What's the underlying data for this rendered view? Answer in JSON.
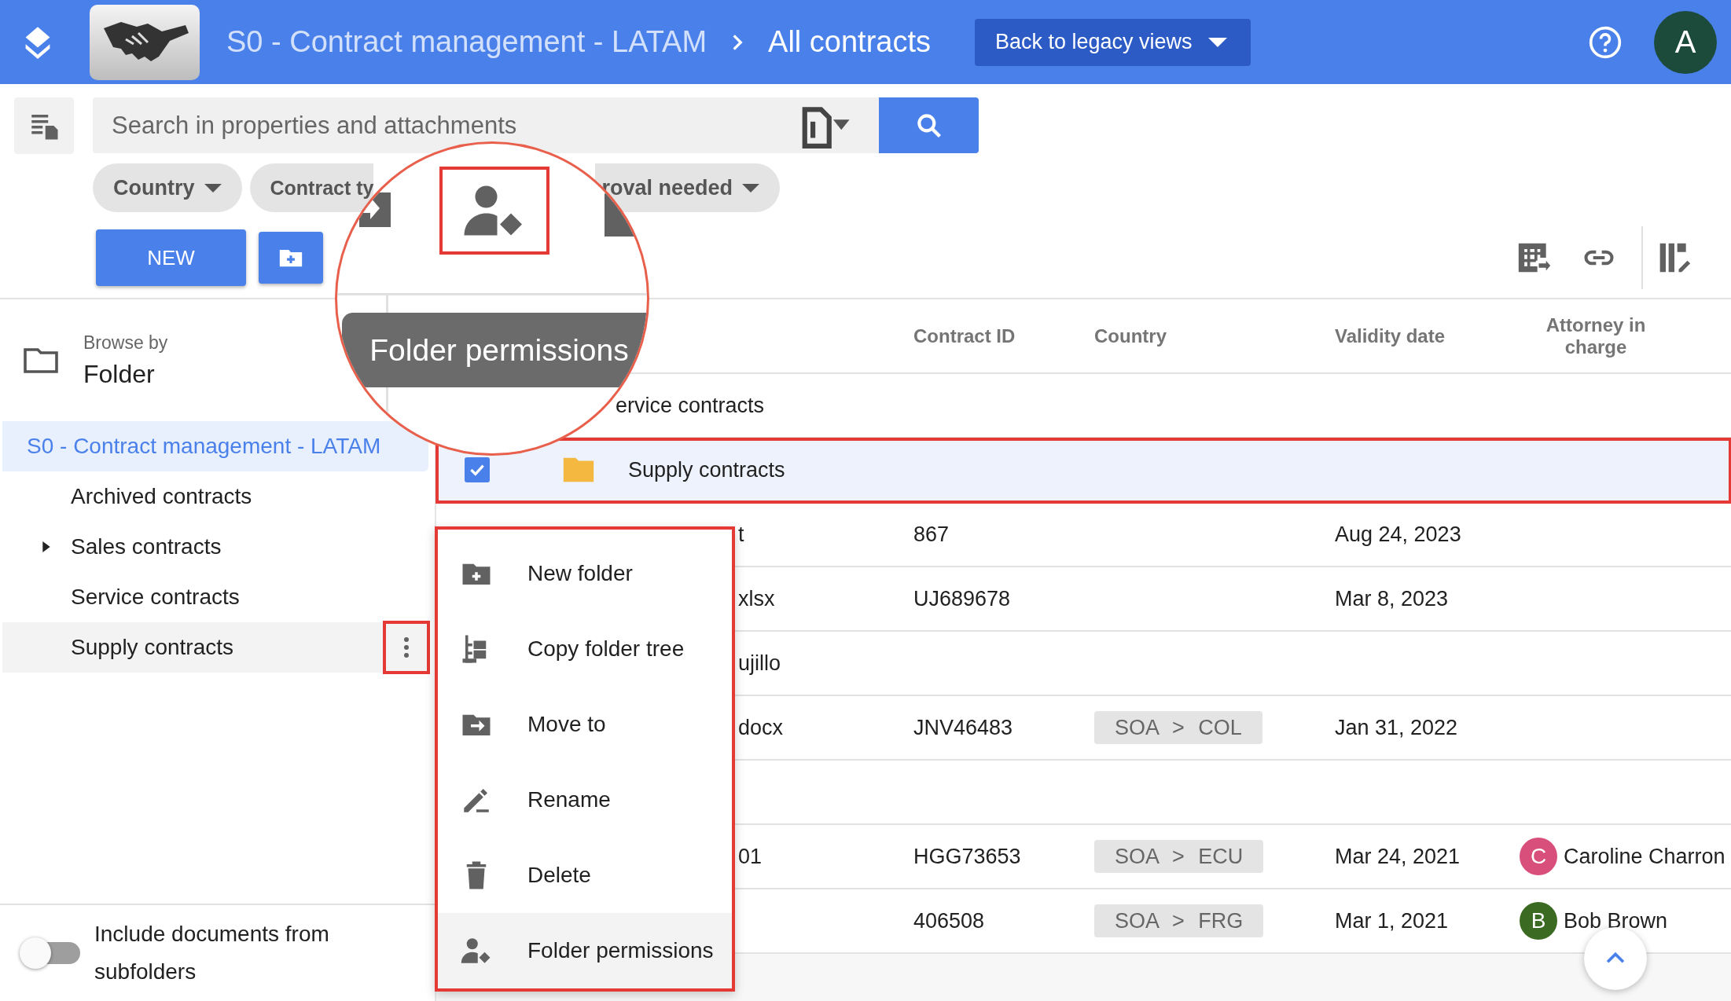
{
  "header": {
    "breadcrumb": [
      "S0 - Contract management - LATAM",
      "All contracts"
    ],
    "legacy_button": "Back to legacy views",
    "avatar": "A"
  },
  "search": {
    "placeholder": "Search in properties and attachments"
  },
  "filters": [
    {
      "label": "Country",
      "kind": "full"
    },
    {
      "label": "Contract ty",
      "kind": "cut-right"
    },
    {
      "label": "roval needed",
      "kind": "cut-left"
    }
  ],
  "new_button": "NEW",
  "browse": {
    "caption": "Browse by",
    "value": "Folder"
  },
  "tree": [
    {
      "label": "S0 - Contract management - LATAM",
      "selected": true,
      "menu_open": false,
      "children": [
        {
          "label": "Archived contracts",
          "selected": false,
          "menu_open": false,
          "kind": "leaf"
        },
        {
          "label": "Sales contracts",
          "selected": false,
          "menu_open": false,
          "kind": "branch"
        },
        {
          "label": "Service contracts",
          "selected": false,
          "menu_open": false,
          "kind": "leaf"
        },
        {
          "label": "Supply contracts",
          "selected": false,
          "menu_open": true,
          "kind": "leaf"
        }
      ]
    }
  ],
  "toggle": {
    "label": "Include documents from subfolders",
    "on": false
  },
  "table": {
    "columns": [
      "Contract ID",
      "Country",
      "Validity date",
      "Attorney in charge"
    ],
    "rows": [
      {
        "kind": "partial",
        "name": "ervice contracts",
        "selected": false
      },
      {
        "kind": "folder",
        "name": "Supply contracts",
        "selected": true
      },
      {
        "kind": "cut",
        "name": "t",
        "contract_id": "867",
        "validity_date": "Aug 24, 2023"
      },
      {
        "kind": "cut",
        "name": "xlsx",
        "contract_id": "UJ689678",
        "validity_date": "Mar 8, 2023"
      },
      {
        "kind": "cut",
        "name": "ujillo"
      },
      {
        "kind": "cut",
        "name": "docx",
        "contract_id": "JNV46483",
        "country": "SOA > COL",
        "validity_date": "Jan 31, 2022"
      },
      {
        "kind": "cut"
      },
      {
        "kind": "cut",
        "name": "01",
        "contract_id": "HGG73653",
        "country": "SOA > ECU",
        "validity_date": "Mar 24, 2021",
        "attorney": {
          "initial": "C",
          "name": "Caroline Charron",
          "color": "#d94f7c"
        }
      },
      {
        "kind": "cut",
        "contract_id": "406508",
        "country": "SOA > FRG",
        "validity_date": "Mar 1, 2021",
        "attorney": {
          "initial": "B",
          "name": "Bob Brown",
          "color": "#3b6b22"
        }
      }
    ]
  },
  "context_menu": {
    "items": [
      {
        "label": "New folder",
        "kind": "new-folder",
        "selected": false
      },
      {
        "label": "Copy folder tree",
        "kind": "copy-tree",
        "selected": false
      },
      {
        "label": "Move to",
        "kind": "move",
        "selected": false
      },
      {
        "label": "Rename",
        "kind": "rename",
        "selected": false
      },
      {
        "label": "Delete",
        "kind": "delete",
        "selected": false
      },
      {
        "label": "Folder permissions",
        "kind": "permissions",
        "selected": true
      }
    ]
  },
  "magnifier": {
    "tooltip": "Folder permissions"
  }
}
